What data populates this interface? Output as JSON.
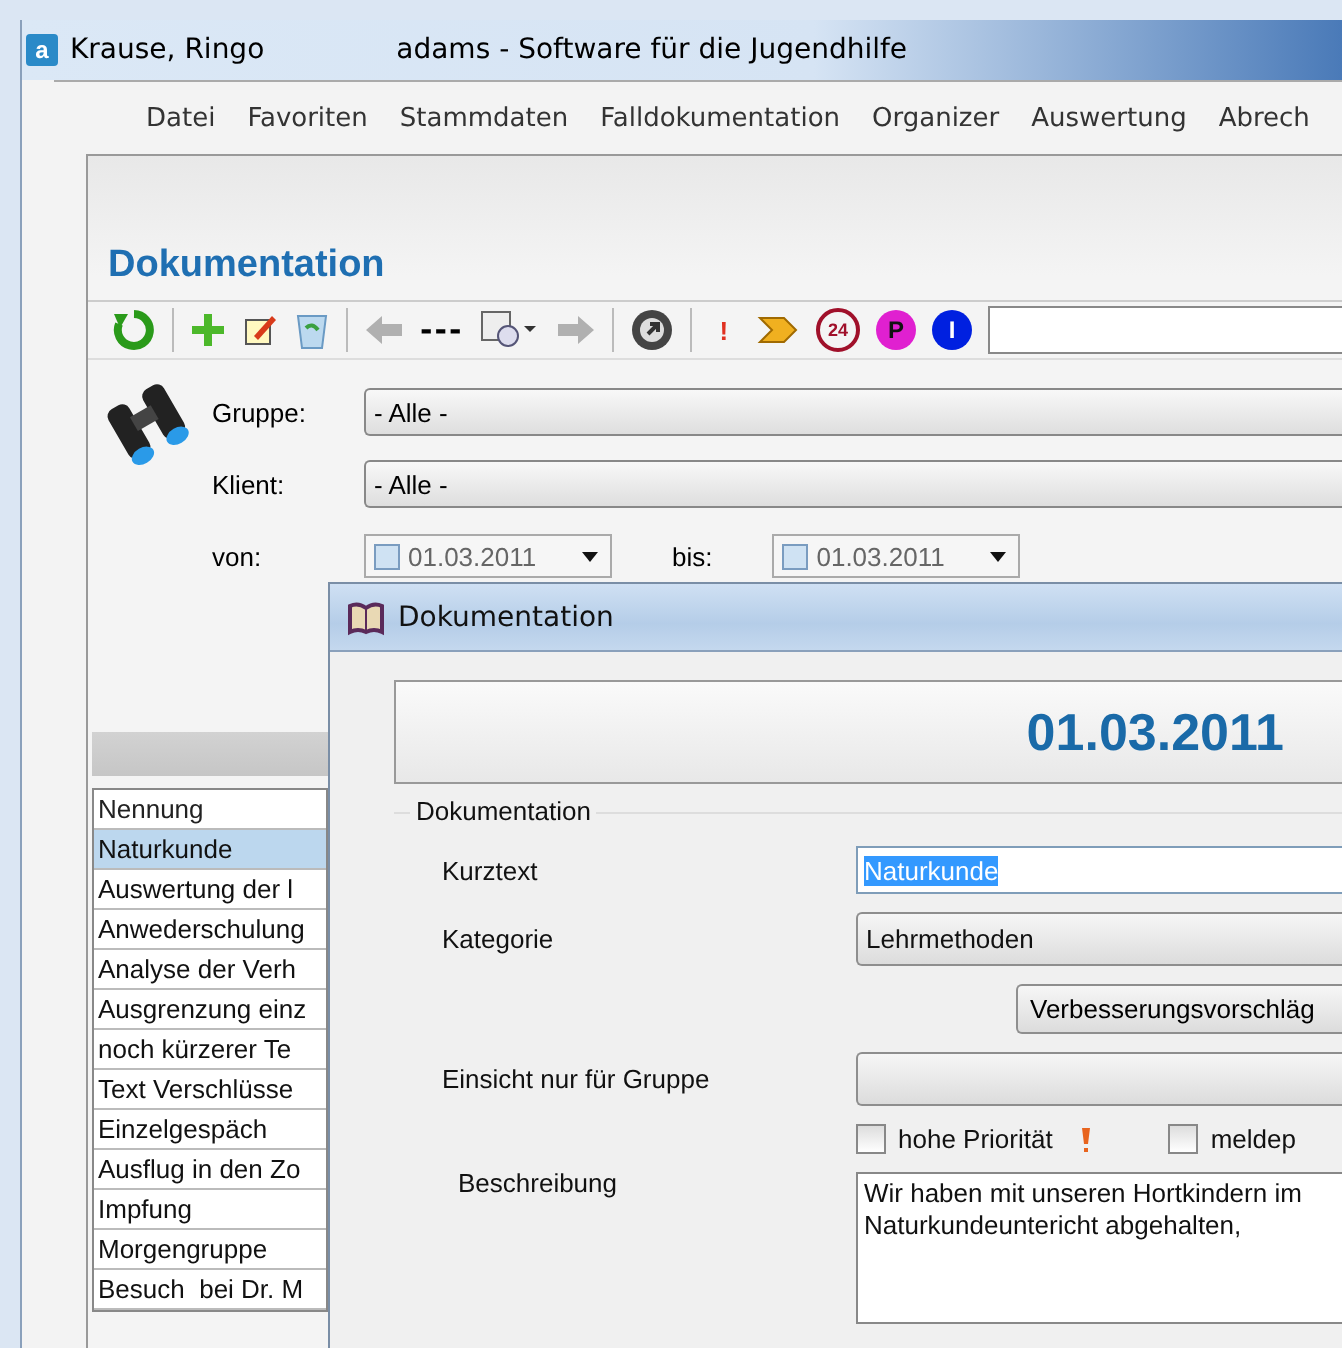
{
  "window": {
    "icon_text": "a",
    "user": "Krause, Ringo",
    "title": "adams - Software für die Jugendhilfe"
  },
  "menu": [
    "Datei",
    "Favoriten",
    "Stammdaten",
    "Falldokumentation",
    "Organizer",
    "Auswertung",
    "Abrech"
  ],
  "heading": "Dokumentation",
  "toolbar": [
    {
      "kind": "refresh"
    },
    {
      "kind": "sep"
    },
    {
      "kind": "add"
    },
    {
      "kind": "edit"
    },
    {
      "kind": "bin"
    },
    {
      "kind": "sep"
    },
    {
      "kind": "back"
    },
    {
      "kind": "text",
      "text": "---"
    },
    {
      "kind": "calendar"
    },
    {
      "kind": "forward"
    },
    {
      "kind": "sep"
    },
    {
      "kind": "go"
    },
    {
      "kind": "sep"
    },
    {
      "kind": "mark",
      "text": "!",
      "color": "#e03020"
    },
    {
      "kind": "flag"
    },
    {
      "kind": "clock",
      "text": "24",
      "color": "#a0102a"
    },
    {
      "kind": "badge",
      "text": "P",
      "color": "#e020d0"
    },
    {
      "kind": "badge",
      "text": "I",
      "color": "#0020e0"
    },
    {
      "kind": "search"
    }
  ],
  "filters": {
    "gruppe": {
      "label": "Gruppe:",
      "value": "- Alle -"
    },
    "klient": {
      "label": "Klient:",
      "value": "- Alle -"
    },
    "von": {
      "label": "von:",
      "value": "01.03.2011",
      "checked": false
    },
    "bis": {
      "label": "bis:",
      "value": "01.03.2011",
      "checked": false
    }
  },
  "table": {
    "columns": [
      "Nennung"
    ],
    "rows": [
      {
        "text": "Naturkunde",
        "selected": true
      },
      {
        "text": "Auswertung der l",
        "selected": false
      },
      {
        "text": "Anwederschulung",
        "selected": false
      },
      {
        "text": "Analyse der Verh",
        "selected": false
      },
      {
        "text": "Ausgrenzung einz",
        "selected": false
      },
      {
        "text": "noch kürzerer Te",
        "selected": false
      },
      {
        "text": "Text Verschlüsse",
        "selected": false
      },
      {
        "text": "Einzelgespäch",
        "selected": false
      },
      {
        "text": "Ausflug in den Zo",
        "selected": false
      },
      {
        "text": "Impfung",
        "selected": false
      },
      {
        "text": "Morgengruppe",
        "selected": false
      },
      {
        "text": "Besuch  bei Dr. M",
        "selected": false
      }
    ]
  },
  "dialog": {
    "title": "Dokumentation",
    "date": "01.03.2011",
    "group": "Dokumentation",
    "kurztext": {
      "label": "Kurztext",
      "value": "Naturkunde"
    },
    "kategorie": {
      "label": "Kategorie",
      "value": "Lehrmethoden"
    },
    "button": "Verbesserungsvorschläg",
    "einsicht": {
      "label": "Einsicht nur für Gruppe"
    },
    "checks": [
      {
        "label": "hohe Priorität",
        "checked": false,
        "flag": true
      },
      {
        "label": "meldep",
        "checked": false,
        "flag": false
      }
    ],
    "beschreibung": {
      "label": "Beschreibung",
      "lines": [
        "Wir haben mit unseren Hortkindern im",
        "Naturkundeuntericht abgehalten,"
      ]
    }
  }
}
